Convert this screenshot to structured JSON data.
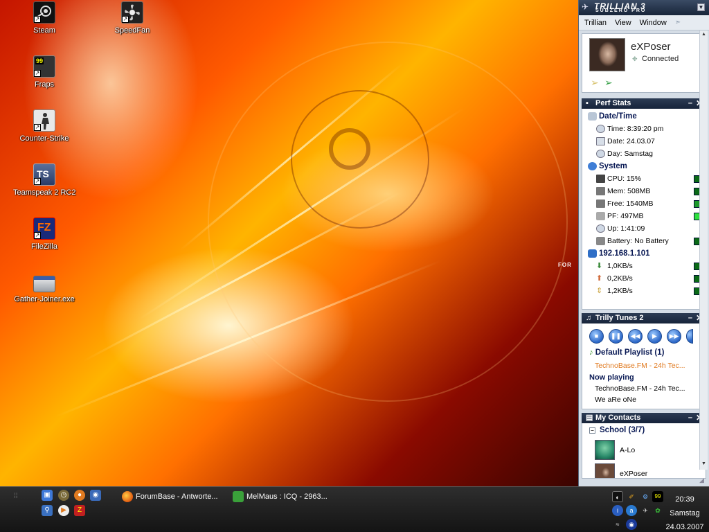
{
  "desktop": {
    "icons": [
      {
        "label": "Steam",
        "icon": "steam-icon"
      },
      {
        "label": "SpeedFan",
        "icon": "speedfan-icon"
      },
      {
        "label": "Fraps",
        "icon": "fraps-icon",
        "badge": "99"
      },
      {
        "label": "Counter-Strike",
        "icon": "counter-strike-icon"
      },
      {
        "label": "Teamspeak 2 RC2",
        "icon": "teamspeak-icon",
        "badge": "TS"
      },
      {
        "label": "FileZilla",
        "icon": "filezilla-icon",
        "badge": "FZ"
      },
      {
        "label": "Gather-Joiner.exe",
        "icon": "executable-icon"
      }
    ],
    "wallpaper_text": "FOR"
  },
  "trillian": {
    "logo": "TRILLIAN 3",
    "logo_sub": "SUBZERO PRO",
    "menu": [
      "Trillian",
      "View",
      "Window"
    ],
    "profile": {
      "name": "eXPoser",
      "status": "Connected"
    },
    "perf": {
      "title": "Perf Stats",
      "datetime_heading": "Date/Time",
      "time": "Time: 8:39:20 pm",
      "date": "Date: 24.03.07",
      "day": "Day: Samstag",
      "system_heading": "System",
      "cpu": "CPU: 15%",
      "mem": "Mem: 508MB",
      "free": "Free: 1540MB",
      "pf": "PF: 497MB",
      "up": "Up: 1:41:09",
      "battery": "Battery: No Battery",
      "ip_heading": "192.168.1.101",
      "down": "1,0KB/s",
      "upload": "0,2KB/s",
      "total": "1,2KB/s"
    },
    "tunes": {
      "title": "Trilly Tunes 2",
      "playlist": "Default Playlist (1)",
      "playlist_item": "TechnoBase.FM - 24h Tec...",
      "now_playing_label": "Now playing",
      "now_playing_track": "TechnoBase.FM - 24h Tec...",
      "now_playing_artist": "We aRe oNe"
    },
    "contacts": {
      "title": "My Contacts",
      "group": "School (3/7)",
      "items": [
        "A-Lo",
        "eXPoser"
      ]
    }
  },
  "taskbar": {
    "tasks": [
      {
        "label": "ForumBase - Antworte...",
        "icon": "firefox-icon"
      },
      {
        "label": "MelMaus : ICQ - 2963...",
        "icon": "icq-icon"
      }
    ],
    "clock": {
      "time": "20:39",
      "day": "Samstag",
      "date": "24.03.2007"
    }
  },
  "colors": {
    "accent": "#16233a",
    "meter": "#0a6a16",
    "orange": "#e07a20"
  }
}
